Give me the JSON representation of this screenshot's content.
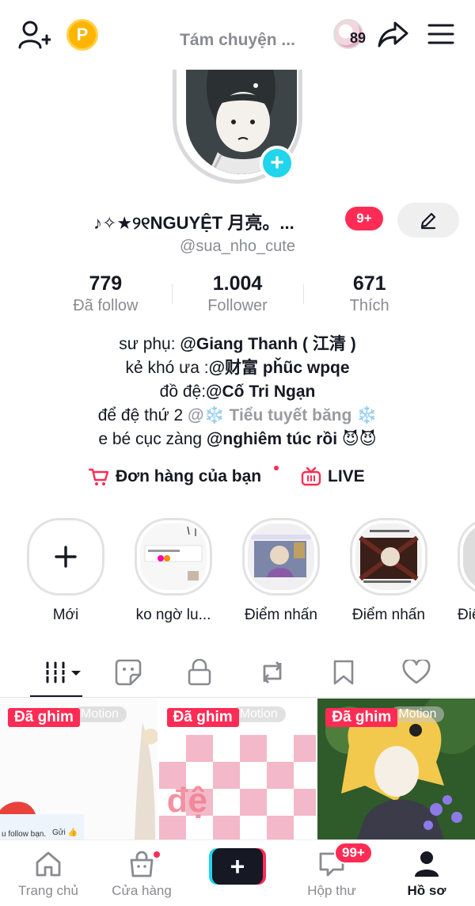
{
  "top_bar": {
    "status_text": "Tám chuyện ...",
    "points_label": "P",
    "friends_count": "89"
  },
  "profile": {
    "display_name": "♪✧★୨୧NGUYỆT 月亮。...",
    "notif_badge": "9+",
    "username": "@sua_nho_cute"
  },
  "stats": [
    {
      "value": "779",
      "label": "Đã follow"
    },
    {
      "value": "1.004",
      "label": "Follower"
    },
    {
      "value": "671",
      "label": "Thích"
    }
  ],
  "bio": {
    "line1_prefix": "sư phụ: ",
    "line1_mention": "@Giang Thanh ( 江清 )",
    "line2_prefix": "kẻ khó ưa :",
    "line2_mention": "@财富 pȟũc wpqe",
    "line3_prefix": "đồ đệ:",
    "line3_mention": "@Cố Tri Ngạn",
    "line4_prefix": "để đệ thứ 2 ",
    "line4_mention": "@❄️ Tiểu tuyết băng ❄️",
    "line5_prefix": "e bé cục zàng ",
    "line5_mention": "@nghiêm túc rồi 😈😈"
  },
  "links": {
    "shop_label": "Đơn hàng của bạn",
    "live_label": "LIVE"
  },
  "highlights": [
    {
      "label": "Mới"
    },
    {
      "label": "ko ngờ lu..."
    },
    {
      "label": "Điểm nhấn"
    },
    {
      "label": "Điểm nhấn"
    },
    {
      "label": "Điể"
    }
  ],
  "tabs": [
    "videos-grid",
    "stickers",
    "private",
    "reposts",
    "favorites",
    "liked"
  ],
  "grid": [
    {
      "pin_label": "Đã ghim",
      "watermark": "Motion",
      "caption": "u follow bạn.",
      "caption2": "Gửi 👍"
    },
    {
      "pin_label": "Đã ghim",
      "watermark": "Motion",
      "overlay_text": "đệ"
    },
    {
      "pin_label": "Đã ghim",
      "watermark": "Motion"
    }
  ],
  "bottom_nav": {
    "home": "Trang chủ",
    "shop": "Cửa hàng",
    "inbox": "Hộp thư",
    "inbox_badge": "99+",
    "profile": "Hồ sơ"
  },
  "colors": {
    "accent": "#fe2c55",
    "cyan": "#20d5ec",
    "text": "#161823",
    "muted": "#8a8b91"
  }
}
